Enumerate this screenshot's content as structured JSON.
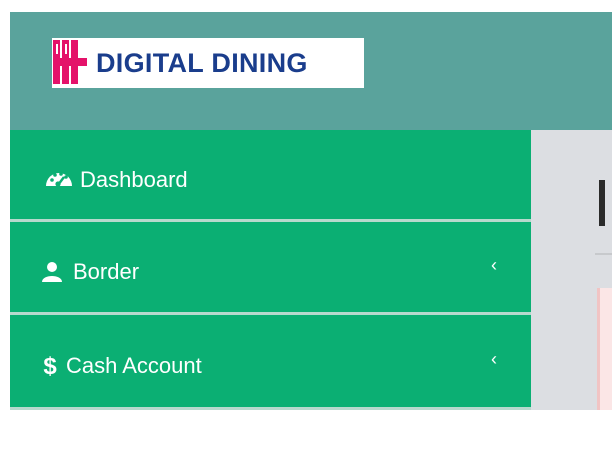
{
  "brand": {
    "name": "DIGITAL DINING",
    "colors": {
      "header_bg": "#5aa39c",
      "sidebar_bg": "#0baf73",
      "logo_text": "#1a3d8c",
      "logo_mark": "#e4126a"
    }
  },
  "sidebar": {
    "items": [
      {
        "label": "Dashboard",
        "icon": "dashboard-icon",
        "has_submenu": false
      },
      {
        "label": "Border",
        "icon": "user-icon",
        "has_submenu": true
      },
      {
        "label": "Cash Account",
        "icon": "dollar-icon",
        "has_submenu": true
      }
    ],
    "submenu_chevron": "‹"
  }
}
